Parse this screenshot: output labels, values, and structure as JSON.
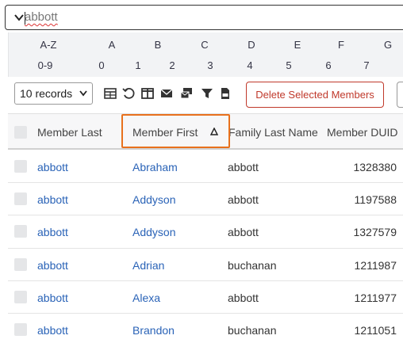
{
  "search": {
    "value": "abbott"
  },
  "alpha_filter": {
    "row1": [
      "A-Z",
      "A",
      "B",
      "C",
      "D",
      "E",
      "F",
      "G"
    ],
    "row2": [
      "0-9",
      "0",
      "1",
      "2",
      "3",
      "4",
      "5",
      "6",
      "7"
    ]
  },
  "toolbar": {
    "records_selected": "10 records",
    "icons": [
      "table-icon",
      "undo-icon",
      "columns-icon",
      "envelope-icon",
      "mail-merge-icon",
      "filter-icon",
      "csv-file-icon"
    ],
    "delete_label": "Delete Selected Members"
  },
  "table": {
    "columns": [
      "Member Last",
      "Member First",
      "Family Last Name",
      "Member DUID"
    ],
    "sorted_column": "Member First",
    "sort_direction": "ascending",
    "rows": [
      {
        "last": "abbott",
        "first": "Abraham",
        "family": "abbott",
        "duid": "1328380"
      },
      {
        "last": "abbott",
        "first": "Addyson",
        "family": "abbott",
        "duid": "1197588"
      },
      {
        "last": "abbott",
        "first": "Addyson",
        "family": "abbott",
        "duid": "1327579"
      },
      {
        "last": "abbott",
        "first": "Adrian",
        "family": "buchanan",
        "duid": "1211987"
      },
      {
        "last": "abbott",
        "first": "Alexa",
        "family": "abbott",
        "duid": "1211977"
      },
      {
        "last": "abbott",
        "first": "Brandon",
        "family": "buchanan",
        "duid": "1211051"
      }
    ]
  },
  "colors": {
    "link": "#2a63b7",
    "danger": "#c0392b",
    "highlight": "#e8711d"
  }
}
